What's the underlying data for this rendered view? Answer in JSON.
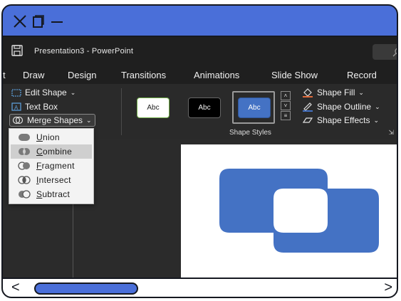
{
  "colors": {
    "accent": "#4a6fd9",
    "shape_fill": "#4472c4",
    "frame": "#151820"
  },
  "window_controls": {
    "close_icon": "close-icon",
    "restore_icon": "restore-icon",
    "minimize_icon": "minimize-icon"
  },
  "app": {
    "title": "Presentation3  -  PowerPoint",
    "save_icon": "save-icon",
    "search_icon": "search-icon"
  },
  "tabs": [
    "t",
    "Draw",
    "Design",
    "Transitions",
    "Animations",
    "Slide Show",
    "Record"
  ],
  "ribbon": {
    "edit_shape": "Edit Shape",
    "text_box": "Text Box",
    "merge_shapes": "Merge Shapes",
    "shape_styles_label": "Shape Styles",
    "style_sample": "Abc",
    "shape_fill": "Shape Fill",
    "shape_outline": "Shape Outline",
    "shape_effects": "Shape Effects"
  },
  "merge_menu": {
    "items": [
      {
        "label": "Union",
        "underline": "U",
        "rest": "nion"
      },
      {
        "label": "Combine",
        "underline": "C",
        "rest": "ombine"
      },
      {
        "label": "Fragment",
        "underline": "F",
        "rest": "ragment"
      },
      {
        "label": "Intersect",
        "underline": "I",
        "rest": "ntersect"
      },
      {
        "label": "Subtract",
        "underline": "S",
        "rest": "ubtract"
      }
    ],
    "selected": "Combine"
  },
  "scrollbar": {
    "left_arrow": "<",
    "right_arrow": ">"
  }
}
